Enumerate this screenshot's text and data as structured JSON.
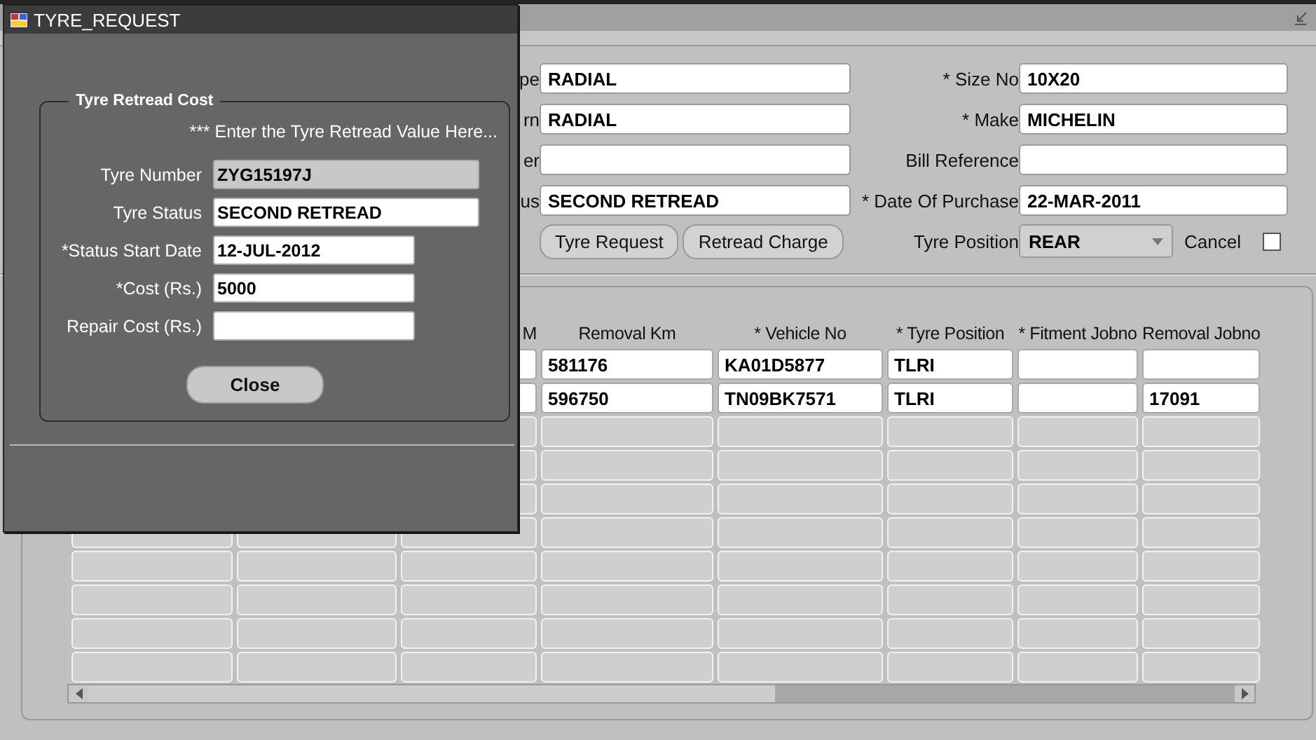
{
  "main_window": {
    "form": {
      "left_fields": [
        {
          "label": "pe",
          "value": "RADIAL"
        },
        {
          "label": "rn",
          "value": "RADIAL"
        },
        {
          "label": "er"
        },
        {
          "label": "us",
          "value": "SECOND RETREAD"
        }
      ],
      "right_fields": [
        {
          "label": "* Size No",
          "value": "10X20"
        },
        {
          "label": "* Make",
          "value": "MICHELIN"
        },
        {
          "label": "Bill Reference"
        },
        {
          "label": "* Date Of Purchase",
          "value": "22-MAR-2011"
        }
      ],
      "buttons": [
        "Tyre Request",
        "Retread Charge"
      ],
      "tyre_position": {
        "label": "Tyre Position",
        "value": "REAR"
      },
      "cancel": {
        "label": "Cancel",
        "checked": false
      }
    },
    "table": {
      "columns": [
        null,
        null,
        "M",
        "Removal Km",
        "* Vehicle No",
        "* Tyre Position",
        "* Fitment Jobno",
        "Removal Jobno"
      ],
      "rows": [
        {
          "active": true,
          "cells": [
            null,
            null,
            null,
            "581176",
            "KA01D5877",
            "TLRI",
            null,
            null
          ]
        },
        {
          "active": true,
          "cells": [
            null,
            null,
            null,
            "596750",
            "TN09BK7571",
            "TLRI",
            null,
            "17091"
          ]
        },
        {
          "active": false
        },
        {
          "active": false
        },
        {
          "active": false
        },
        {
          "active": false
        },
        {
          "active": false
        },
        {
          "active": false
        },
        {
          "active": false
        },
        {
          "active": false
        }
      ]
    }
  },
  "dialog": {
    "title": "TYRE_REQUEST",
    "group_title": "Tyre Retread Cost",
    "hint": "*** Enter the Tyre Retread Value Here...",
    "fields": [
      {
        "label": "Tyre Number",
        "value": "ZYG15197J",
        "disabled": true
      },
      {
        "label": "Tyre Status",
        "value": "SECOND RETREAD",
        "disabled": false
      },
      {
        "label": "*Status Start Date",
        "value": "12-JUL-2012",
        "disabled": false
      },
      {
        "label": "*Cost (Rs.)",
        "value": "5000",
        "disabled": false
      },
      {
        "label": "Repair Cost (Rs.)",
        "disabled": false
      }
    ],
    "close_button": "Close"
  }
}
